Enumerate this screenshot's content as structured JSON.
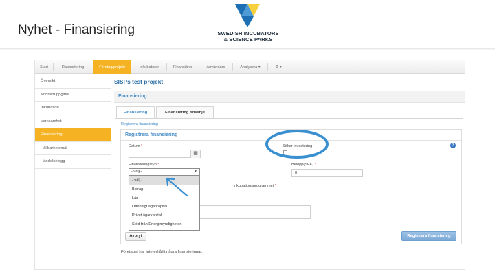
{
  "slide": {
    "title": "Nyhet - Finansiering",
    "logo_line1": "SWEDISH INCUBATORS",
    "logo_line2": "& SCIENCE PARKS"
  },
  "colors": {
    "accent_orange": "#f5b324",
    "link_blue": "#3b86c4",
    "annotation_blue": "#3a8fd1",
    "logo_blue": "#1c6fb3",
    "logo_yellow": "#f7d13d"
  },
  "navbar": {
    "items": [
      "Start",
      "Rapportering",
      "Företag/projekt",
      "Inkubatorer",
      "Finansiärer",
      "Användare",
      "Analysera ▾",
      "⚙ ▾"
    ],
    "active_index": 2
  },
  "sidebar": {
    "items": [
      "Översikt",
      "Kontaktuppgifter",
      "Inkubation",
      "Verksamhet",
      "Finansiering",
      "Hållbarhetsmål",
      "Händelselogg"
    ],
    "active_index": 4
  },
  "main": {
    "title": "SISPs test projekt",
    "section_title": "Finansiering",
    "tabs": [
      "Finansiering",
      "Finansiering tidslinje"
    ],
    "active_tab": 0,
    "register_link": "Registrera finansiering"
  },
  "form": {
    "title": "Registrera finansiering",
    "date_label": "Datum",
    "date_value": "",
    "seeking_label": "Söker investering",
    "seeking_checked": false,
    "type_label": "Finansieringstyp",
    "type_selected": "- välj -",
    "amount_label": "Belopp(SEK)",
    "amount_value": "0",
    "incubation_label_partial": "nkubationsprogrammet",
    "required_mark": "*",
    "dropdown_options": [
      "- välj -",
      "Bidrag",
      "Lån",
      "Offentligt ägarkapital",
      "Privat ägarkapital",
      "Stöd från Energimyndigheten"
    ],
    "cancel_label": "Avbryt",
    "submit_label": "Registrera finansiering"
  },
  "footer_note": "Företaget har inte erhållit några finansieringar."
}
